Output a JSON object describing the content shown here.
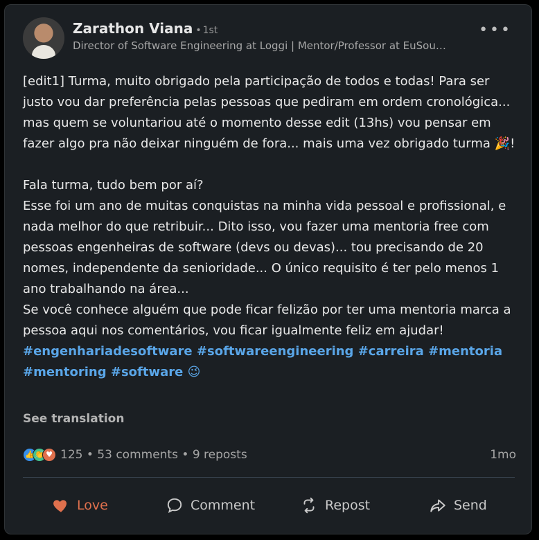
{
  "author": {
    "name": "Zarathon Viana",
    "degree": "1st",
    "headline": "Director of Software Engineering at Loggi | Mentor/Professor at EuSou…"
  },
  "post": {
    "edit_paragraph": "[edit1] Turma, muito obrigado pela participação de todos e todas! Para ser justo vou dar preferência pelas pessoas que pediram em ordem cronológica... mas quem se voluntariou até o momento desse edit (13hs) vou pensar em fazer algo pra não deixar ninguém de fora... mais uma vez obrigado turma 🎉!",
    "greeting": "Fala turma, tudo bem por aí?",
    "body": "Esse foi um ano de muitas conquistas na minha vida pessoal e profissional, e nada melhor do que retribuir... Dito isso, vou fazer uma mentoria free com pessoas engenheiras de software (devs ou devas)... tou precisando de 20 nomes, independente da senioridade... O único requisito é ter pelo menos 1 ano trabalhando na área...",
    "closing": "Se você conhece alguém que pode ficar felizão por ter uma mentoria marca a pessoa aqui nos comentários, vou ficar igualmente feliz em ajudar!",
    "hashtags": [
      "#engenhariadesoftware",
      "#softwareengineering",
      "#carreira",
      "#mentoria",
      "#mentoring",
      "#software"
    ],
    "emoji": "😉"
  },
  "see_translation": "See translation",
  "stats": {
    "reactions": "125",
    "comments": "53 comments",
    "reposts": "9 reposts",
    "time": "1mo",
    "reaction_icons": [
      "like-icon",
      "clap-icon",
      "heart-icon"
    ]
  },
  "actions": {
    "love": "Love",
    "comment": "Comment",
    "repost": "Repost",
    "send": "Send"
  },
  "colors": {
    "background": "#1b1f23",
    "hashtag": "#5aa6e8",
    "love": "#df704d"
  }
}
